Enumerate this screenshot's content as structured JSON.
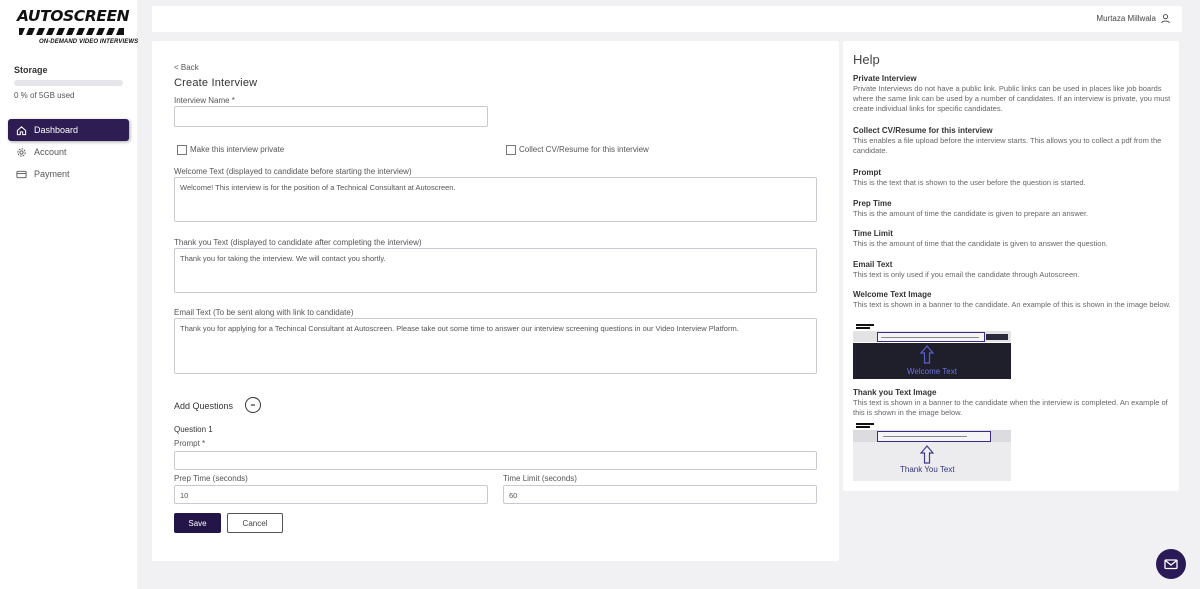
{
  "brand": {
    "name": "AUTOSCREEN",
    "tagline": "ON-DEMAND VIDEO INTERVIEWS"
  },
  "storage": {
    "title": "Storage",
    "used_text": "0 % of 5GB used",
    "used_fraction": 0.0
  },
  "nav": [
    {
      "label": "Dashboard",
      "icon": "home-icon",
      "active": true
    },
    {
      "label": "Account",
      "icon": "gear-icon",
      "active": false
    },
    {
      "label": "Payment",
      "icon": "credit-card-icon",
      "active": false
    }
  ],
  "topbar": {
    "user_name": "Murtaza Millwala",
    "user_icon": "user-icon"
  },
  "form": {
    "back_label": "< Back",
    "title": "Create Interview",
    "interview_name": {
      "label": "Interview Name *",
      "value": ""
    },
    "private_checkbox": {
      "label": "Make this interview private",
      "checked": false
    },
    "cv_checkbox": {
      "label": "Collect CV/Resume for this interview",
      "checked": false
    },
    "welcome_text": {
      "label": "Welcome Text (displayed to candidate before starting the interview)",
      "value": "Welcome! This interview is for the position of a Technical Consultant at Autoscreen."
    },
    "thankyou_text": {
      "label": "Thank you Text (displayed to candidate after completing the interview)",
      "value": "Thank you for taking the interview. We will contact you shortly."
    },
    "email_text": {
      "label": "Email Text (To be sent along with link to candidate)",
      "value": "Thank you for applying for a Techincal Consultant at Autoscreen. Please take out some time to answer our interview screening questions in our Video Interview Platform."
    },
    "add_questions_label": "Add Questions",
    "add_questions_icon": "minus-circle-icon",
    "question": {
      "title": "Question 1",
      "prompt_label": "Prompt *",
      "prompt_value": "",
      "prep_label": "Prep Time (seconds)",
      "prep_value": "10",
      "limit_label": "Time Limit (seconds)",
      "limit_value": "60"
    },
    "save_label": "Save",
    "cancel_label": "Cancel"
  },
  "help": {
    "title": "Help",
    "sections": [
      {
        "heading": "Private Interview",
        "body": "Private Interviews do not have a public link. Public links can be used in places like job boards where the same link can be used by a number of candidates. If an interview is private, you must create individual links for specific candidates."
      },
      {
        "heading": "Collect CV/Resume for this interview",
        "body": "This enables a file upload before the interview starts. This allows you to collect a pdf from the candidate."
      },
      {
        "heading": "Prompt",
        "body": "This is the text that is shown to the user before the question is started."
      },
      {
        "heading": "Prep Time",
        "body": "This is the amount of time the candidate is given to prepare an answer."
      },
      {
        "heading": "Time Limit",
        "body": "This is the amount of time that the candidate is given to answer the question."
      },
      {
        "heading": "Email Text",
        "body": "This text is only used if you email the candidate through Autoscreen."
      },
      {
        "heading": "Welcome Text Image",
        "body": "This text is shown in a banner to the candidate. An example of this is shown in the image below."
      },
      {
        "heading": "Thank you Text Image",
        "body": "This text is shown in a banner to the candidate when the interview is completed. An example of this is shown in the image below."
      }
    ],
    "welcome_image_caption": "Welcome Text",
    "thankyou_image_caption": "Thank You Text"
  },
  "colors": {
    "primary": "#231548",
    "sidebar_active": "#2e1d52",
    "page_bg": "#f1f1f4"
  },
  "fab_icon": "mail-icon"
}
